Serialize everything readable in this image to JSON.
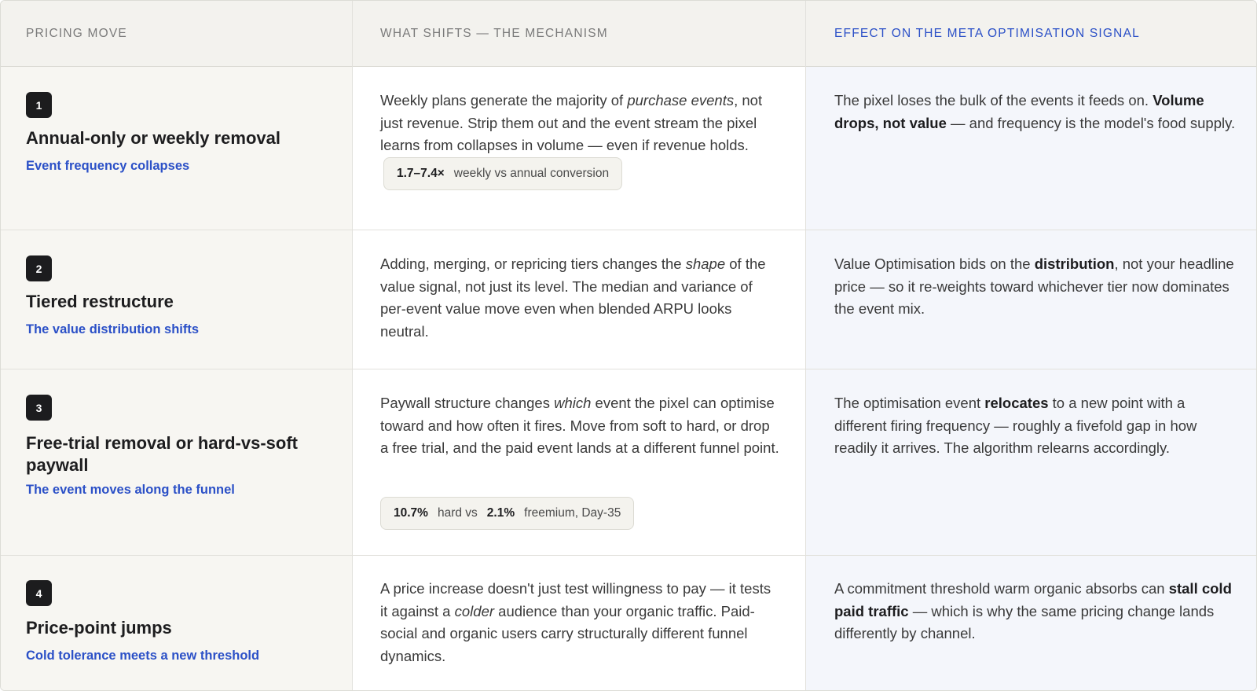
{
  "header": {
    "col1": "PRICING MOVE",
    "col2": "WHAT SHIFTS — THE MECHANISM",
    "col3": "EFFECT ON THE META OPTIMISATION SIGNAL"
  },
  "rows": [
    {
      "number": "1",
      "title": "Annual-only or weekly removal",
      "subtitle": "Event frequency collapses",
      "mechanism": {
        "p1": "Weekly plans generate the majority of ",
        "em1": "purchase events",
        "p2": ", not just revenue. Strip them out and the event stream the pixel learns from collapses in volume — even if revenue holds.",
        "pill_value": "1.7–7.4×",
        "pill_text": "weekly vs annual conversion"
      },
      "effect": {
        "p1": "The pixel loses the bulk of the events it feeds on. ",
        "b1": "Volume drops, not value",
        "p2": " — and frequency is the model's food supply."
      }
    },
    {
      "number": "2",
      "title": "Tiered restructure",
      "subtitle": "The value distribution shifts",
      "mechanism": {
        "p1": "Adding, merging, or repricing tiers changes the ",
        "em1": "shape",
        "p2": " of the value signal, not just its level. The median and variance of per-event value move even when blended ARPU looks neutral."
      },
      "effect": {
        "p1": "Value Optimisation bids on the ",
        "b1": "distribution",
        "p2": ", not your headline price — so it re-weights toward whichever tier now dominates the event mix."
      }
    },
    {
      "number": "3",
      "title": "Free-trial removal or hard-vs-soft paywall",
      "subtitle": "The event moves along the funnel",
      "mechanism": {
        "p1": "Paywall structure changes ",
        "em1": "which",
        "p2": " event the pixel can optimise toward and how often it fires. Move from soft to hard, or drop a free trial, and the paid event lands at a different funnel point.",
        "pill_value1": "10.7%",
        "pill_text1": "hard vs",
        "pill_value2": "2.1%",
        "pill_text2": "freemium, Day-35"
      },
      "effect": {
        "p1": "The optimisation event ",
        "b1": "relocates",
        "p2": " to a new point with a different firing frequency — roughly a fivefold gap in how readily it arrives. The algorithm relearns accordingly."
      }
    },
    {
      "number": "4",
      "title": "Price-point jumps",
      "subtitle": "Cold tolerance meets a new threshold",
      "mechanism": {
        "p1": "A price increase doesn't just test willingness to pay — it tests it against a ",
        "em1": "colder",
        "p2": " audience than your organic traffic. Paid-social and organic users carry structurally different funnel dynamics."
      },
      "effect": {
        "p1": "A commitment threshold warm organic absorbs can ",
        "b1": "stall cold paid traffic",
        "p2": " — which is why the same pricing change lands differently by channel."
      }
    }
  ]
}
